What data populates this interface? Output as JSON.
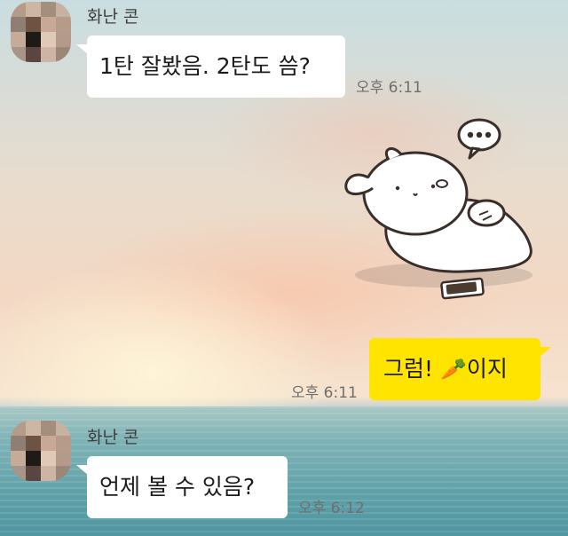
{
  "messages": [
    {
      "sender": "화난 콘",
      "text": "1탄 잘봤음. 2탄도 씀?",
      "time": "오후 6:11"
    },
    {
      "sticker": "sticker-icon",
      "text_before_emoji": "그럼! ",
      "emoji": "🥕",
      "text_after_emoji": "이지",
      "time": "오후 6:11"
    },
    {
      "sender": "화난 콘",
      "text": "언제 볼 수 있음?",
      "time": "오후 6:12"
    }
  ],
  "colors": {
    "my_bubble": "#ffe400",
    "their_bubble": "#ffffff",
    "time_text": "#6f6f6f"
  }
}
